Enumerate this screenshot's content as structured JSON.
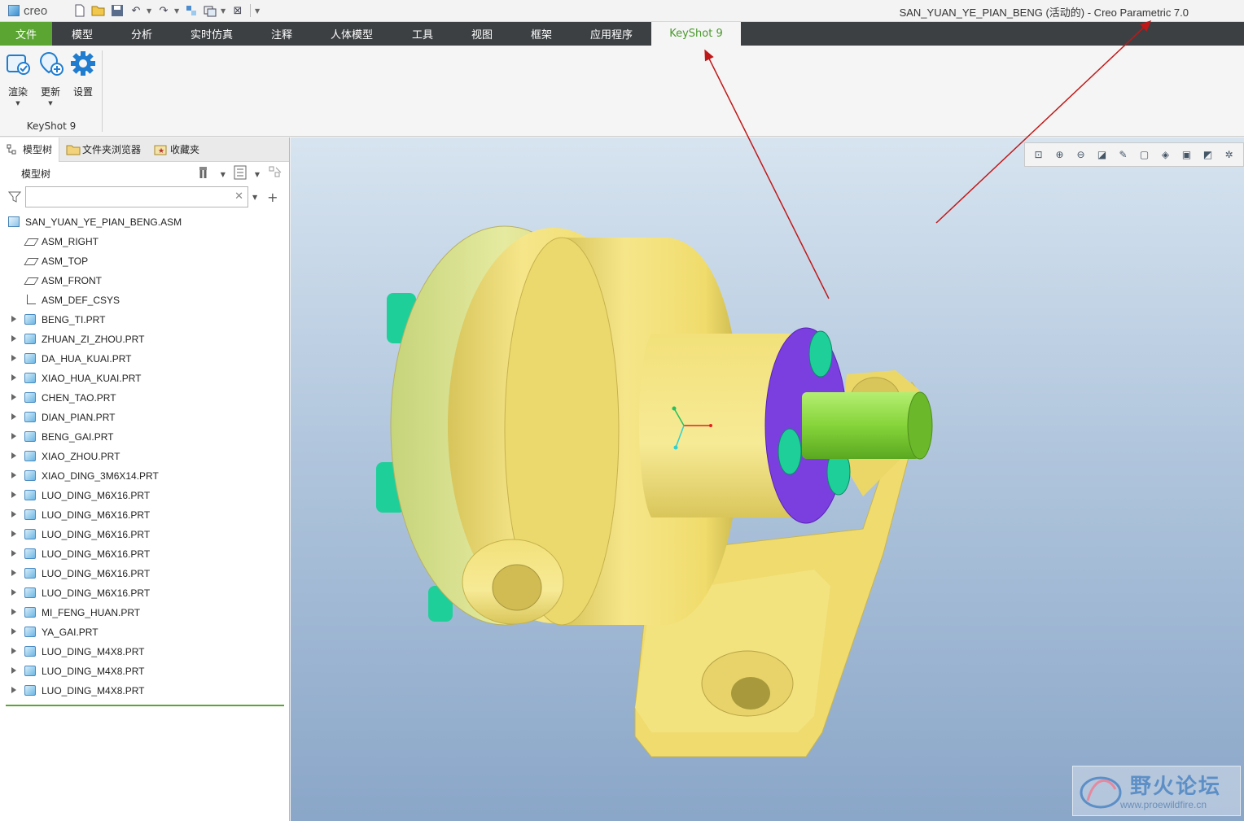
{
  "app": {
    "logo_text": "creo",
    "window_title": "SAN_YUAN_YE_PIAN_BENG (活动的) - Creo Parametric 7.0"
  },
  "quick_access": [
    "new-icon",
    "open-icon",
    "save-icon",
    "undo-icon",
    "redo-icon",
    "regenerate-icon",
    "windows-icon",
    "close-window-icon",
    "customize-icon"
  ],
  "menu": {
    "tabs": [
      {
        "label": "文件",
        "width": 64
      },
      {
        "label": "模型",
        "width": 74
      },
      {
        "label": "分析",
        "width": 72
      },
      {
        "label": "实时仿真",
        "width": 100
      },
      {
        "label": "注释",
        "width": 72
      },
      {
        "label": "人体模型",
        "width": 100
      },
      {
        "label": "工具",
        "width": 74
      },
      {
        "label": "视图",
        "width": 72
      },
      {
        "label": "框架",
        "width": 74
      },
      {
        "label": "应用程序",
        "width": 98
      },
      {
        "label": "KeyShot 9",
        "width": 110
      }
    ],
    "active": "KeyShot 9"
  },
  "ribbon": {
    "buttons": [
      {
        "label": "渲染",
        "icon": "render-icon"
      },
      {
        "label": "更新",
        "icon": "update-icon"
      },
      {
        "label": "设置",
        "icon": "settings-gear-icon"
      }
    ],
    "group_label": "KeyShot 9"
  },
  "panel": {
    "tabs": [
      {
        "label": "模型树",
        "icon": "model-tree-icon"
      },
      {
        "label": "文件夹浏览器",
        "icon": "folder-browser-icon"
      },
      {
        "label": "收藏夹",
        "icon": "favorites-icon"
      }
    ],
    "tree_title": "模型树",
    "search_value": "",
    "search_placeholder": ""
  },
  "tree": [
    {
      "label": "SAN_YUAN_YE_PIAN_BENG.ASM",
      "type": "asm",
      "expandable": false
    },
    {
      "label": "ASM_RIGHT",
      "type": "plane",
      "expandable": false
    },
    {
      "label": "ASM_TOP",
      "type": "plane",
      "expandable": false
    },
    {
      "label": "ASM_FRONT",
      "type": "plane",
      "expandable": false
    },
    {
      "label": "ASM_DEF_CSYS",
      "type": "csys",
      "expandable": false
    },
    {
      "label": "BENG_TI.PRT",
      "type": "prt",
      "expandable": true
    },
    {
      "label": "ZHUAN_ZI_ZHOU.PRT",
      "type": "prt",
      "expandable": true
    },
    {
      "label": "DA_HUA_KUAI.PRT",
      "type": "prt",
      "expandable": true
    },
    {
      "label": "XIAO_HUA_KUAI.PRT",
      "type": "prt",
      "expandable": true
    },
    {
      "label": "CHEN_TAO.PRT",
      "type": "prt",
      "expandable": true
    },
    {
      "label": "DIAN_PIAN.PRT",
      "type": "prt",
      "expandable": true
    },
    {
      "label": "BENG_GAI.PRT",
      "type": "prt",
      "expandable": true
    },
    {
      "label": "XIAO_ZHOU.PRT",
      "type": "prt",
      "expandable": true
    },
    {
      "label": "XIAO_DING_3M6X14.PRT",
      "type": "prt",
      "expandable": true
    },
    {
      "label": "LUO_DING_M6X16.PRT",
      "type": "prt",
      "expandable": true
    },
    {
      "label": "LUO_DING_M6X16.PRT",
      "type": "prt",
      "expandable": true
    },
    {
      "label": "LUO_DING_M6X16.PRT",
      "type": "prt",
      "expandable": true
    },
    {
      "label": "LUO_DING_M6X16.PRT",
      "type": "prt",
      "expandable": true
    },
    {
      "label": "LUO_DING_M6X16.PRT",
      "type": "prt",
      "expandable": true
    },
    {
      "label": "LUO_DING_M6X16.PRT",
      "type": "prt",
      "expandable": true
    },
    {
      "label": "MI_FENG_HUAN.PRT",
      "type": "prt",
      "expandable": true
    },
    {
      "label": "YA_GAI.PRT",
      "type": "prt",
      "expandable": true
    },
    {
      "label": "LUO_DING_M4X8.PRT",
      "type": "prt",
      "expandable": true
    },
    {
      "label": "LUO_DING_M4X8.PRT",
      "type": "prt",
      "expandable": true
    },
    {
      "label": "LUO_DING_M4X8.PRT",
      "type": "prt",
      "expandable": true
    }
  ],
  "view_toolbar": [
    "refit-icon",
    "zoom-in-icon",
    "zoom-out-icon",
    "repaint-icon",
    "view-manager-icon",
    "saved-views-icon",
    "display-style-icon",
    "perspective-icon",
    "spin-center-icon",
    "datum-display-icon"
  ],
  "watermark": {
    "title": "野火论坛",
    "url": "www.proewildfire.cn"
  },
  "colors": {
    "file_tab": "#5ba532",
    "menubar": "#3d4043",
    "active_tab_text": "#4a9a2b",
    "model_body": "#f0df72",
    "shaft": "#86d43a",
    "flange": "#7b3fe0",
    "screws": "#1fcf9a",
    "annotation_arrow": "#c01818"
  }
}
